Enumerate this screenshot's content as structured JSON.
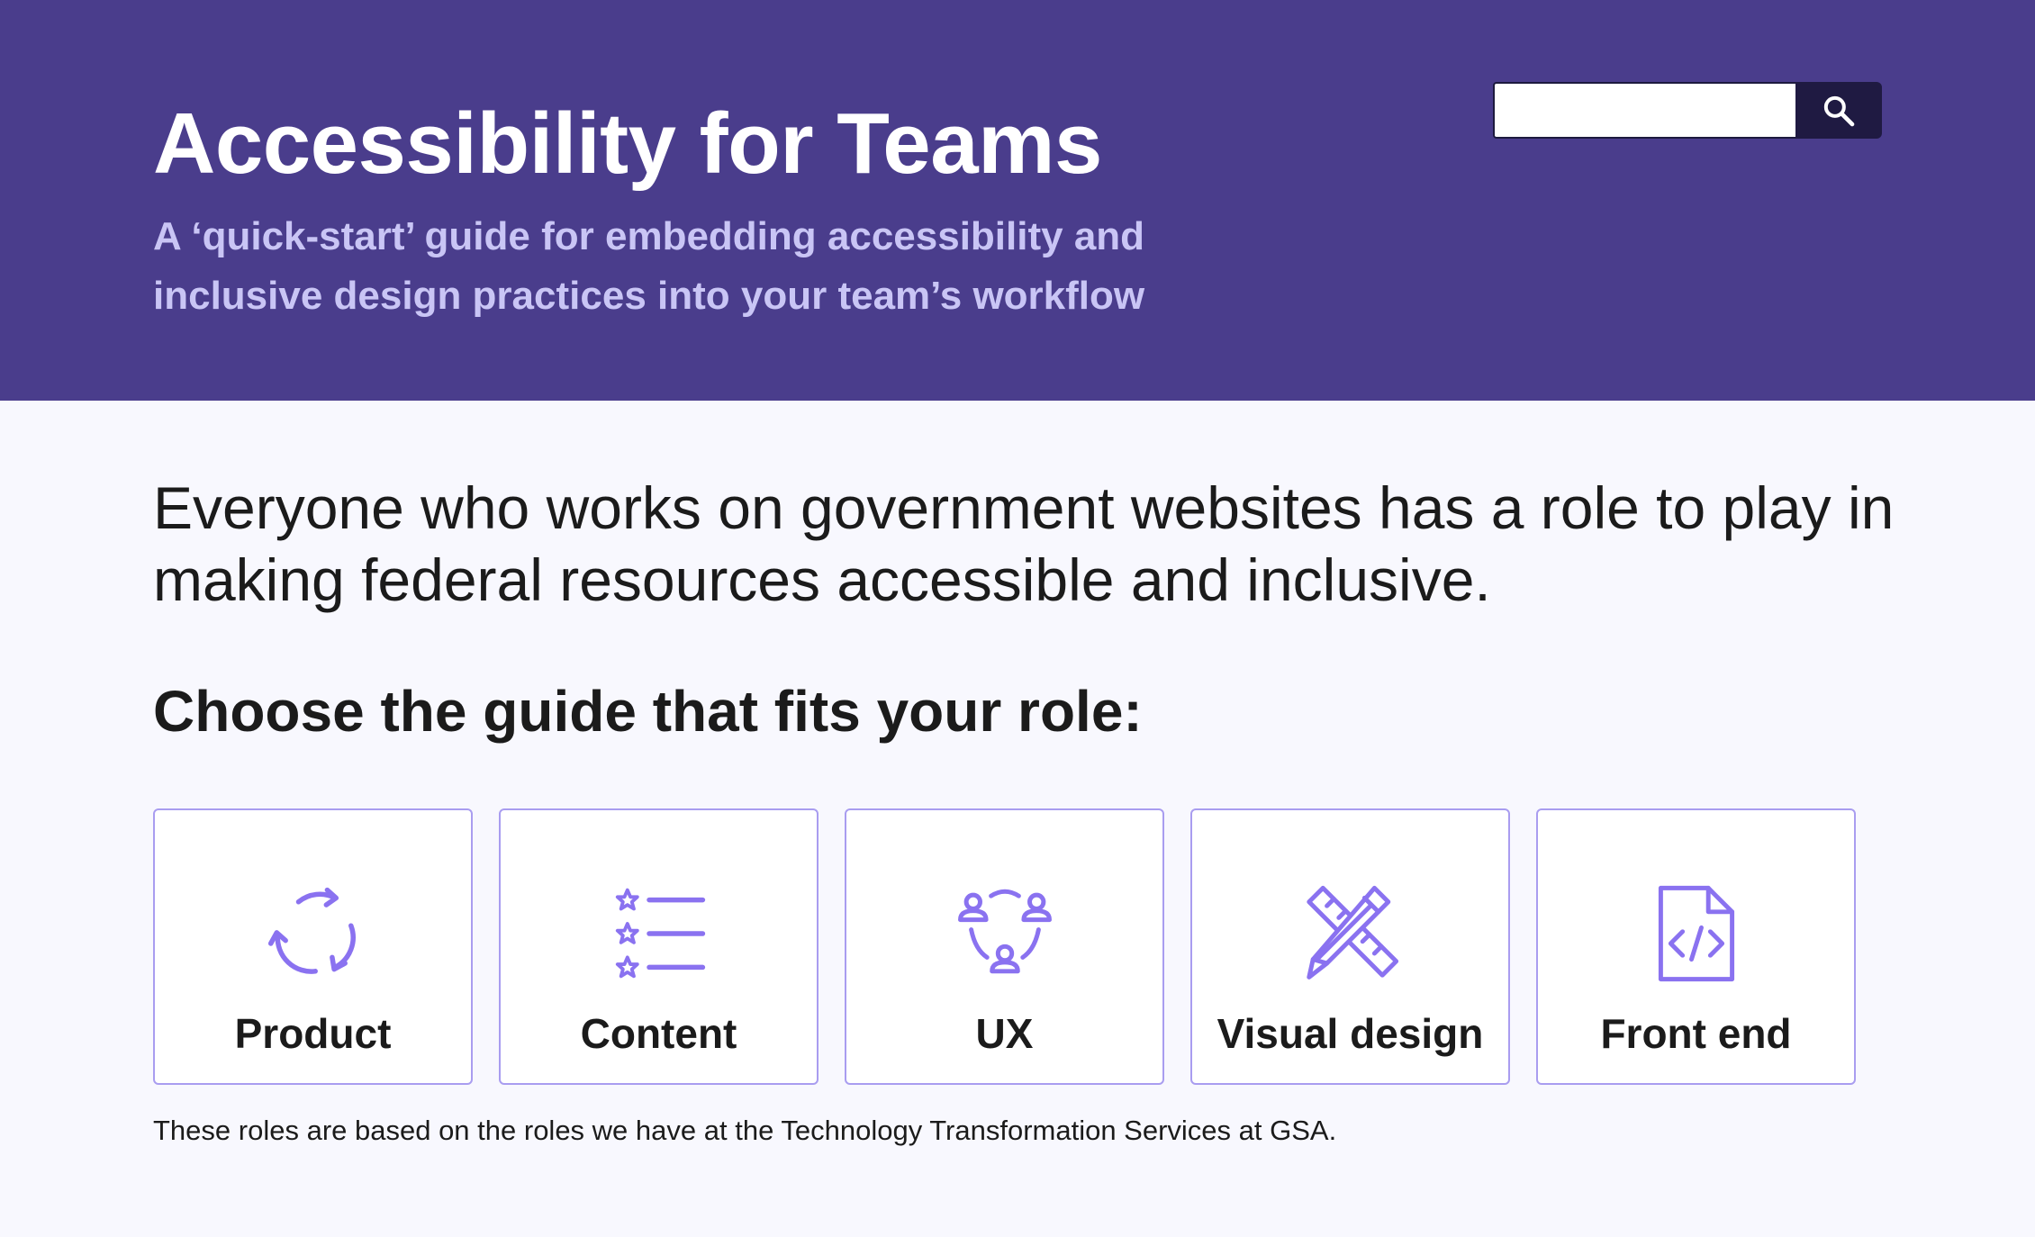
{
  "header": {
    "title": "Accessibility for Teams",
    "subtitle": "A ‘quick-start’ guide for embedding accessibility and inclusive design practices into your team’s workflow",
    "background_color": "#4a3d8c",
    "subtitle_color": "#c9c5f5"
  },
  "search": {
    "value": "",
    "placeholder": "",
    "button_icon": "search-icon",
    "button_color": "#1f1a42"
  },
  "main": {
    "intro": "Everyone who works on government websites has a role to play in making federal resources accessible and inclusive.",
    "choose_heading": "Choose the guide that fits your role:",
    "roles": [
      {
        "label": "Product",
        "icon": "cycle-arrows-icon"
      },
      {
        "label": "Content",
        "icon": "star-list-icon"
      },
      {
        "label": "UX",
        "icon": "user-group-icon"
      },
      {
        "label": "Visual design",
        "icon": "pencil-ruler-icon"
      },
      {
        "label": "Front end",
        "icon": "code-file-icon"
      }
    ],
    "footnote": "These roles are based on the roles we have at the Technology Transformation Services at GSA.",
    "card_border_color": "#a99df0",
    "icon_color": "#8a72f0"
  }
}
